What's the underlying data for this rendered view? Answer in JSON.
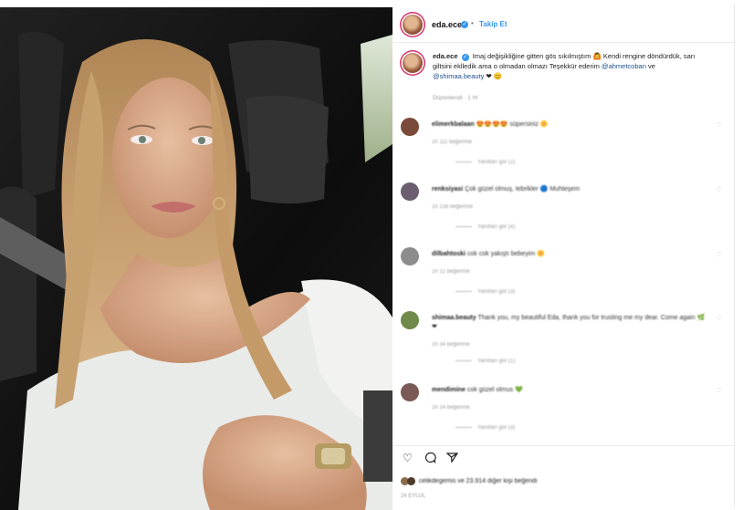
{
  "post": {
    "image_alt": "Selfie of a woman with long blonde hair in a car",
    "header": {
      "username": "eda.ece",
      "verified_icon": "verified-badge-icon",
      "separator": "•",
      "follow_label": "Takip Et"
    },
    "caption": {
      "username": "eda.ece",
      "text_part1": "Imaj değişikliğine gitten gös sıkılmıştım",
      "text_part2": "Kendi rengine döndürdük, sarı giltsini eklledik ama o olmadan olmazı Teşekkür ederim",
      "mention1": "@ahmetcoban",
      "conj": "ve",
      "mention2": "@shimaa.beauty",
      "emoji_end": "❤ 😊",
      "meta": "Düzenlendi · 1 hf"
    },
    "comments": [
      {
        "user": "elimerkbalaan",
        "text": "😍😍😍😍 süpersiniz 🌼",
        "meta": "1h   111 beğenme",
        "replies": "Yanıtları gör (2)",
        "color": "#7a4b3a"
      },
      {
        "user": "renksiyasi",
        "text": "Çok güzel olmuş, tebrikler 🔵 Muhteşem",
        "meta": "1h   138 beğenme",
        "replies": "Yanıtları gör (4)",
        "color": "#6b5e6e"
      },
      {
        "user": "dilbahtoski",
        "text": "cok cok yakıştı bebeyim 🌼",
        "meta": "1h   12 beğenme",
        "replies": "Yanıtları gör (3)",
        "color": "#8c8c8c"
      },
      {
        "user": "shimaa.beauty",
        "text": "Thank you, my beautiful Eda, thank you for trusting me my dear. Come again 🌿❤",
        "meta": "1h   34 beğenme",
        "replies": "Yanıtları gör (1)",
        "color": "#6f8a4a"
      },
      {
        "user": "mendimine",
        "text": "cok güzel olmus 💚",
        "meta": "1h   14 beğenme",
        "replies": "Yanıtları gör (3)",
        "color": "#7a5a55"
      }
    ],
    "actions": [
      "heart-icon",
      "comment-icon",
      "share-icon"
    ],
    "likes": {
      "label_user": "celikdegemis",
      "label_rest": "ve 23.914 diğer kişi beğendi"
    },
    "date": "24 EYLÜL"
  }
}
